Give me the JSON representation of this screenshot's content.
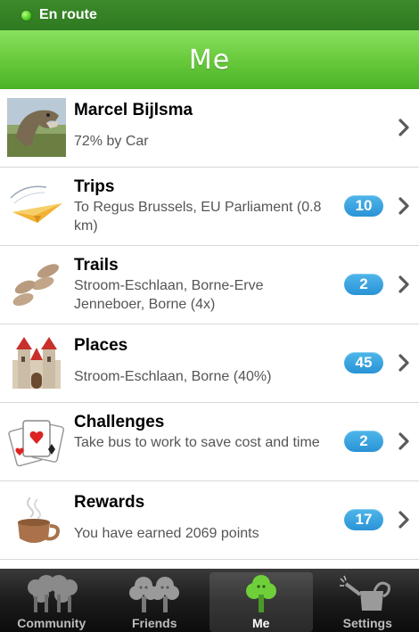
{
  "status": {
    "text": "En route",
    "dot_color": "#3fc418"
  },
  "header": {
    "title": "Me"
  },
  "profile": {
    "name": "Marcel Bijlsma",
    "subtitle": "72% by Car",
    "avatar_icon": "dinosaur-avatar"
  },
  "items": [
    {
      "title": "Trips",
      "subtitle": "To Regus Brussels, EU Parliament (0.8 km)",
      "count": "10",
      "icon": "paper-plane-icon"
    },
    {
      "title": "Trails",
      "subtitle": "Stroom-Eschlaan, Borne-Erve Jenneboer, Borne (4x)",
      "count": "2",
      "icon": "footprints-icon"
    },
    {
      "title": "Places",
      "subtitle": "Stroom-Eschlaan, Borne (40%)",
      "count": "45",
      "icon": "castle-icon"
    },
    {
      "title": "Challenges",
      "subtitle": "Take bus to work to save cost and time",
      "count": "2",
      "icon": "playing-cards-icon"
    },
    {
      "title": "Rewards",
      "subtitle": "You have earned 2069 points",
      "count": "17",
      "icon": "coffee-cup-icon"
    }
  ],
  "tabs": [
    {
      "label": "Community",
      "icon": "community-trees-icon"
    },
    {
      "label": "Friends",
      "icon": "friends-trees-icon"
    },
    {
      "label": "Me",
      "icon": "me-tree-icon",
      "active": true
    },
    {
      "label": "Settings",
      "icon": "watering-can-icon"
    }
  ],
  "colors": {
    "accent_green": "#5cc233",
    "badge_blue": "#2a93d6"
  }
}
